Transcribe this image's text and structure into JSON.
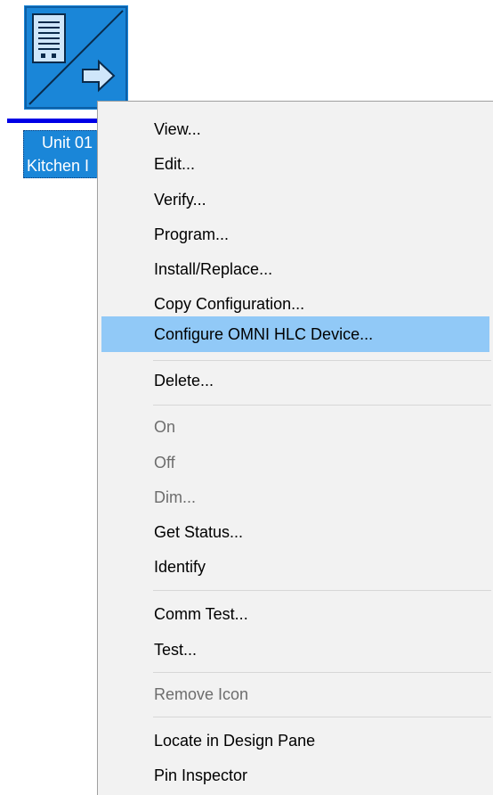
{
  "device": {
    "icon": "device-panel-arrow-icon",
    "label_line1": "Unit 01",
    "label_line2": "Kitchen I",
    "accent_color": "#1a86d8"
  },
  "menu": {
    "items": [
      {
        "label": "View...",
        "enabled": true
      },
      {
        "label": "Edit...",
        "enabled": true
      },
      {
        "label": "Verify...",
        "enabled": true
      },
      {
        "label": "Program...",
        "enabled": true
      },
      {
        "label": "Install/Replace...",
        "enabled": true
      },
      {
        "label": "Copy Configuration...",
        "enabled": true
      },
      {
        "label": "Configure OMNI HLC Device...",
        "enabled": true,
        "highlighted": true
      },
      {
        "label": "Delete...",
        "enabled": true
      },
      {
        "label": "On",
        "enabled": false
      },
      {
        "label": "Off",
        "enabled": false
      },
      {
        "label": "Dim...",
        "enabled": false
      },
      {
        "label": "Get Status...",
        "enabled": true
      },
      {
        "label": "Identify",
        "enabled": true
      },
      {
        "label": "Comm Test...",
        "enabled": true
      },
      {
        "label": "Test...",
        "enabled": true
      },
      {
        "label": "Remove Icon",
        "enabled": false
      },
      {
        "label": "Locate in Design Pane",
        "enabled": true
      },
      {
        "label": "Pin Inspector",
        "enabled": true
      }
    ],
    "highlight_color": "#91c9f7"
  }
}
